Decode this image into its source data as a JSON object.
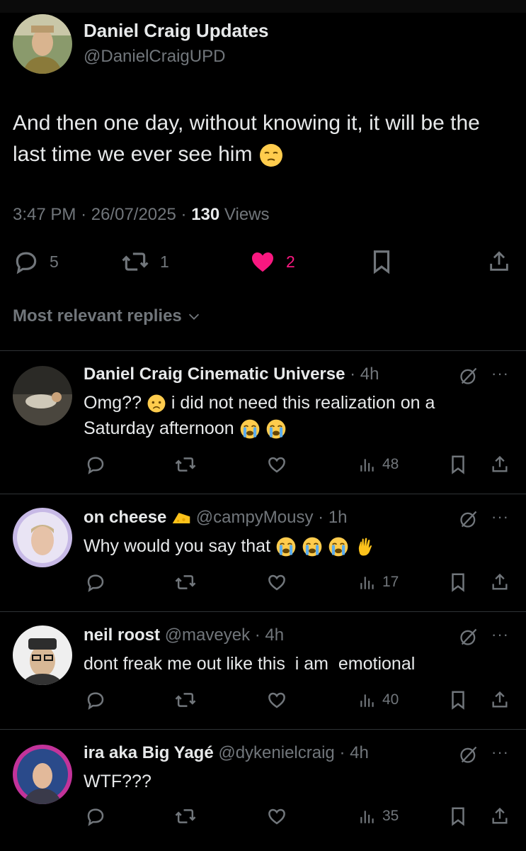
{
  "tweet": {
    "author_name": "Daniel Craig Updates",
    "author_handle": "@DanielCraigUPD",
    "text": "And then one day, without knowing it, it will be the last time we ever see him",
    "time": "3:47 PM",
    "sep1": "·",
    "date": "26/07/2025",
    "sep2": "·",
    "views_count": "130",
    "views_label": "Views",
    "reply_count": "5",
    "repost_count": "1",
    "like_count": "2",
    "like_color": "#f91880"
  },
  "sort": {
    "label": "Most relevant replies"
  },
  "replies": [
    {
      "name": "Daniel Craig Cinematic Universe",
      "handle": "",
      "time": "· 4h",
      "text_a": "Omg??",
      "text_b": "i did not need this realization on a Saturday afternoon",
      "views": "48"
    },
    {
      "name": "on cheese",
      "handle": "@campyMousy",
      "time": "· 1h",
      "text_a": "Why would you say that",
      "views": "17"
    },
    {
      "name": "neil roost",
      "handle": "@maveyek",
      "time": "· 4h",
      "text_a": "dont freak me out like this  i am  emotional",
      "views": "40"
    },
    {
      "name": "ira aka Big Yagé",
      "handle": "@dykenielcraig",
      "time": "· 4h",
      "text_a": "WTF???",
      "views": "35"
    }
  ],
  "colors": {
    "background": "#000000",
    "text": "#e7e9ea",
    "muted": "#71767b",
    "divider": "#2f3336",
    "like": "#f91880"
  }
}
